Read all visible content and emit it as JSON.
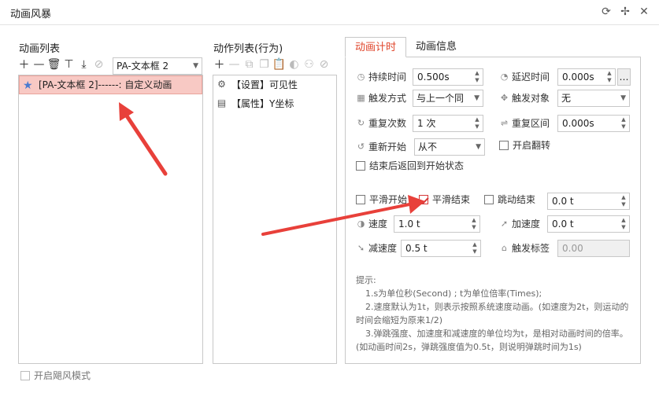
{
  "window": {
    "title": "动画风暴",
    "refresh_icon": "refresh-icon",
    "pin_icon": "pin-icon",
    "close_icon": "close-icon"
  },
  "left": {
    "title": "动画列表",
    "target_select": "PA-文本框 2",
    "items": [
      {
        "label": "[PA-文本框 2]------: 自定义动画"
      }
    ],
    "bottom_checkbox": "开启飓风模式"
  },
  "middle": {
    "title": "动作列表(行为)",
    "items": [
      {
        "label": "【设置】可见性",
        "icon": "gear-icon"
      },
      {
        "label": "【属性】Y坐标",
        "icon": "document-icon"
      }
    ]
  },
  "tabs": [
    {
      "label": "动画计时",
      "active": true
    },
    {
      "label": "动画信息",
      "active": false
    }
  ],
  "timing": {
    "duration_label": "持续时间",
    "duration_value": "0.500s",
    "delay_label": "延迟时间",
    "delay_value": "0.000s",
    "trigger_label": "触发方式",
    "trigger_value": "与上一个同",
    "trigger_target_label": "触发对象",
    "trigger_target_value": "无",
    "repeat_label": "重复次数",
    "repeat_value": "1 次",
    "repeat_range_label": "重复区间",
    "repeat_range_value": "0.000s",
    "restart_label": "重新开始",
    "restart_value": "从不",
    "flip_label": "开启翻转",
    "return_label": "结束后返回到开始状态",
    "smooth_start_label": "平滑开始",
    "smooth_end_label": "平滑结束",
    "bounce_end_label": "跳动结束",
    "bounce_value": "0.0 t",
    "speed_label": "速度",
    "speed_value": "1.0 t",
    "accel_label": "加速度",
    "accel_value": "0.0 t",
    "decel_label": "减速度",
    "decel_value": "0.5 t",
    "trigger_tag_label": "触发标签",
    "trigger_tag_value": "0.00"
  },
  "tips": {
    "heading": "提示:",
    "line1": "1.s为单位秒(Second) ;  t为单位倍率(Times);",
    "line2": "2.速度默认为1t，则表示按照系统速度动画。(如速度为2t，则运动的时间会缩短为原来1/2)",
    "line3": "3.弹跳强度、加速度和减速度的单位均为t，是相对动画时间的倍率。(如动画时间2s，弹跳强度值为0.5t，则说明弹跳时间为1s)"
  },
  "colors": {
    "accent": "#e0452b",
    "selected_bg": "#f8c9c4",
    "arrow_red": "#e8403a"
  }
}
